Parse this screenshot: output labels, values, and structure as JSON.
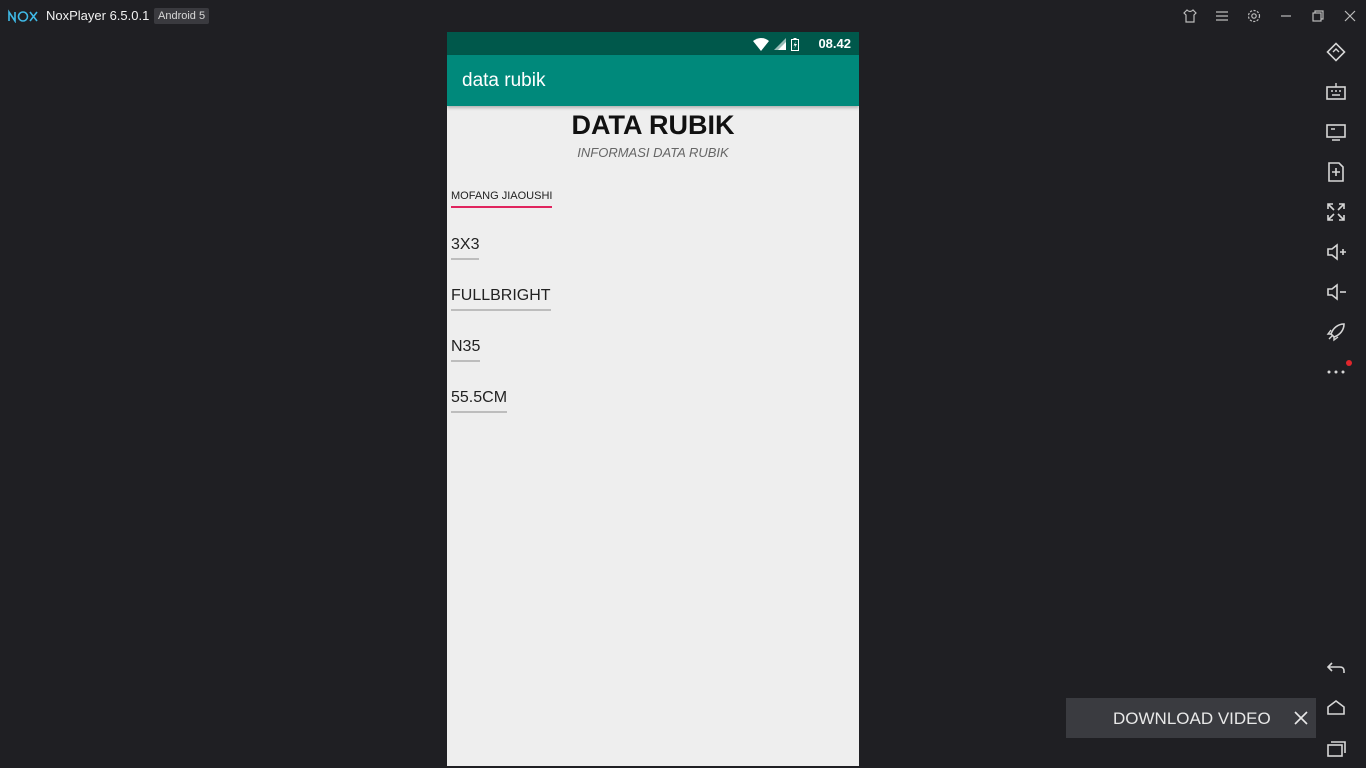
{
  "window": {
    "app_name": "NoxPlayer 6.5.0.1",
    "android_badge": "Android 5",
    "controls": [
      "shirt-icon",
      "menu-icon",
      "gear-icon",
      "minimize-icon",
      "restore-icon",
      "close-icon"
    ]
  },
  "status_bar": {
    "time": "08.42",
    "icons": [
      "wifi-icon",
      "signal-icon",
      "battery-charging-icon"
    ]
  },
  "app_bar": {
    "title": "data rubik"
  },
  "screen": {
    "heading": "DATA RUBIK",
    "subheading": "INFORMASI DATA RUBIK",
    "fields": [
      {
        "value": "MOFANG JIAOUSHI",
        "focused": true
      },
      {
        "value": "3X3",
        "focused": false
      },
      {
        "value": "FULLBRIGHT",
        "focused": false
      },
      {
        "value": "N35",
        "focused": false
      },
      {
        "value": "55.5CM",
        "focused": false
      }
    ]
  },
  "sidebar": {
    "tools": [
      "rotate-icon",
      "keyboard-icon",
      "screen-icon",
      "apk-install-icon",
      "fullscreen-icon",
      "volume-up-icon",
      "volume-down-icon",
      "rocket-icon",
      "more-icon"
    ],
    "nav": [
      "back-icon",
      "home-icon",
      "recents-icon"
    ]
  },
  "download_popup": {
    "label": "DOWNLOAD VIDEO"
  },
  "colors": {
    "status_bar": "#00584b",
    "app_bar": "#00897b",
    "accent": "#e0245e",
    "background": "#1f1f23",
    "screen_bg": "#eeeeee"
  }
}
